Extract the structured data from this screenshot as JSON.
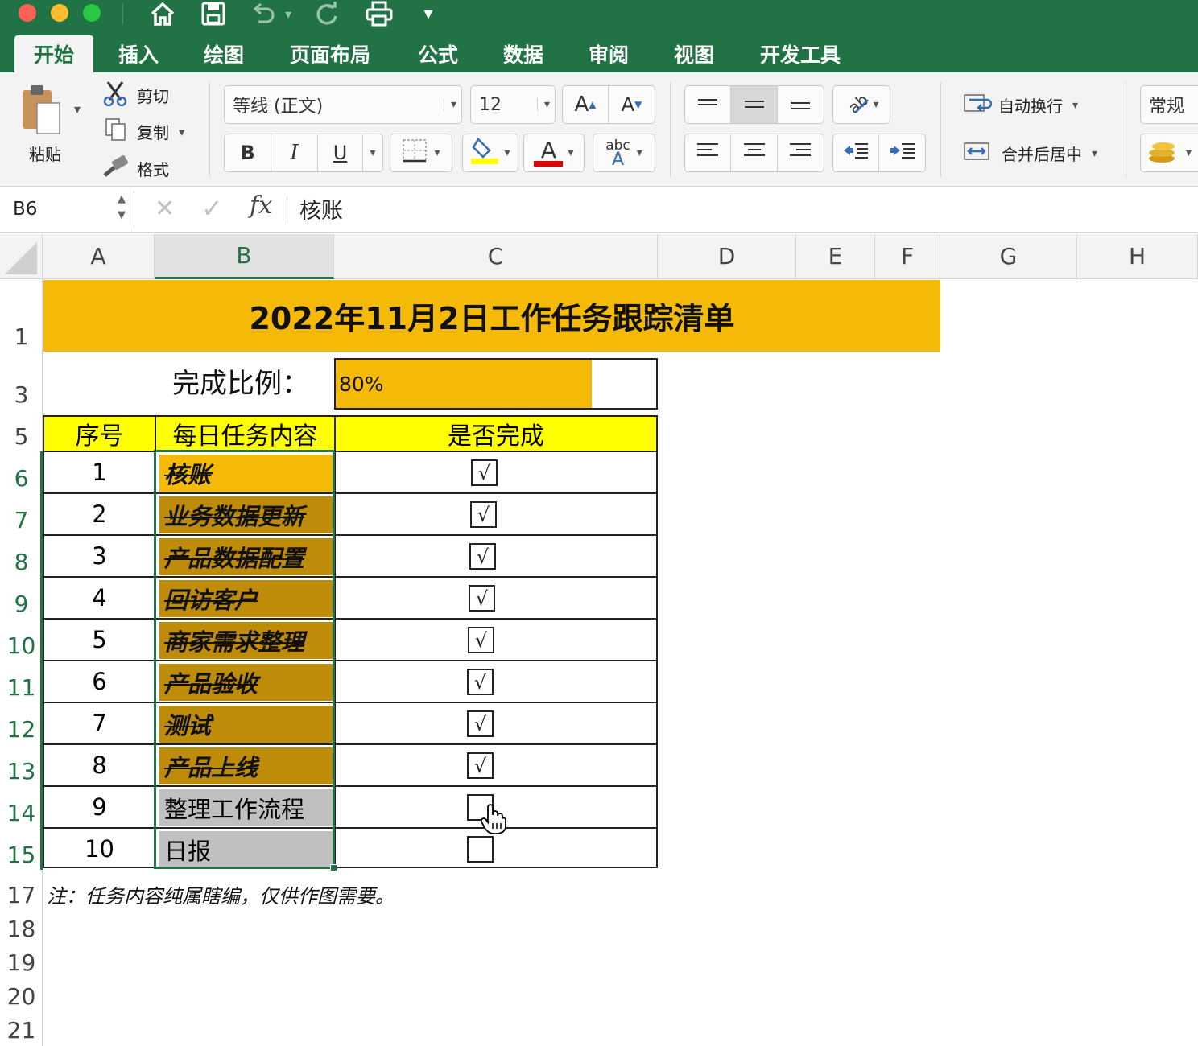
{
  "quick_access": {
    "undo_caret": "▾",
    "more": "▾"
  },
  "tabs": [
    "开始",
    "插入",
    "绘图",
    "页面布局",
    "公式",
    "数据",
    "审阅",
    "视图",
    "开发工具"
  ],
  "ribbon": {
    "paste": "粘贴",
    "cut": "剪切",
    "copy": "复制",
    "format_painter": "格式",
    "font_name": "等线 (正文)",
    "font_size": "12",
    "bold": "B",
    "italic": "I",
    "underline": "U",
    "grow_font": "A",
    "shrink_font": "A",
    "font_color_glyph": "A",
    "phonetic": "abc",
    "wrap_text": "自动换行",
    "merge_center": "合并后居中",
    "number_format": "常规",
    "colors": {
      "fill": "#ffff00",
      "font": "#e00000"
    }
  },
  "formula_bar": {
    "name_box": "B6",
    "fx": "fx",
    "content": "核账"
  },
  "columns": [
    "A",
    "B",
    "C",
    "D",
    "E",
    "F",
    "G",
    "H"
  ],
  "rows": [
    "1",
    "3",
    "5",
    "6",
    "7",
    "8",
    "9",
    "10",
    "11",
    "12",
    "13",
    "14",
    "15",
    "17",
    "18",
    "19",
    "20",
    "21"
  ],
  "sheet": {
    "title": "2022年11月2日工作任务跟踪清单",
    "ratio_label": "完成比例：",
    "ratio_value": "80%",
    "ratio_fraction": 0.8,
    "headers": {
      "seq": "序号",
      "task": "每日任务内容",
      "done": "是否完成"
    },
    "tasks": [
      {
        "seq": "1",
        "task": "核账",
        "done": true
      },
      {
        "seq": "2",
        "task": "业务数据更新",
        "done": true
      },
      {
        "seq": "3",
        "task": "产品数据配置",
        "done": true
      },
      {
        "seq": "4",
        "task": "回访客户",
        "done": true
      },
      {
        "seq": "5",
        "task": "商家需求整理",
        "done": true
      },
      {
        "seq": "6",
        "task": "产品验收",
        "done": true
      },
      {
        "seq": "7",
        "task": "测试",
        "done": true
      },
      {
        "seq": "8",
        "task": "产品上线",
        "done": true
      },
      {
        "seq": "9",
        "task": "整理工作流程",
        "done": false
      },
      {
        "seq": "10",
        "task": "日报",
        "done": false
      }
    ],
    "check_mark": "√",
    "note": "注：任务内容纯属瞎编，仅供作图需要。",
    "colors": {
      "title_bg": "#f5b907",
      "header_bg": "#ffff00",
      "done_bg": "#bf8c0a",
      "active_bg": "#f5b907",
      "pending_bg": "#c0c0c0"
    }
  }
}
